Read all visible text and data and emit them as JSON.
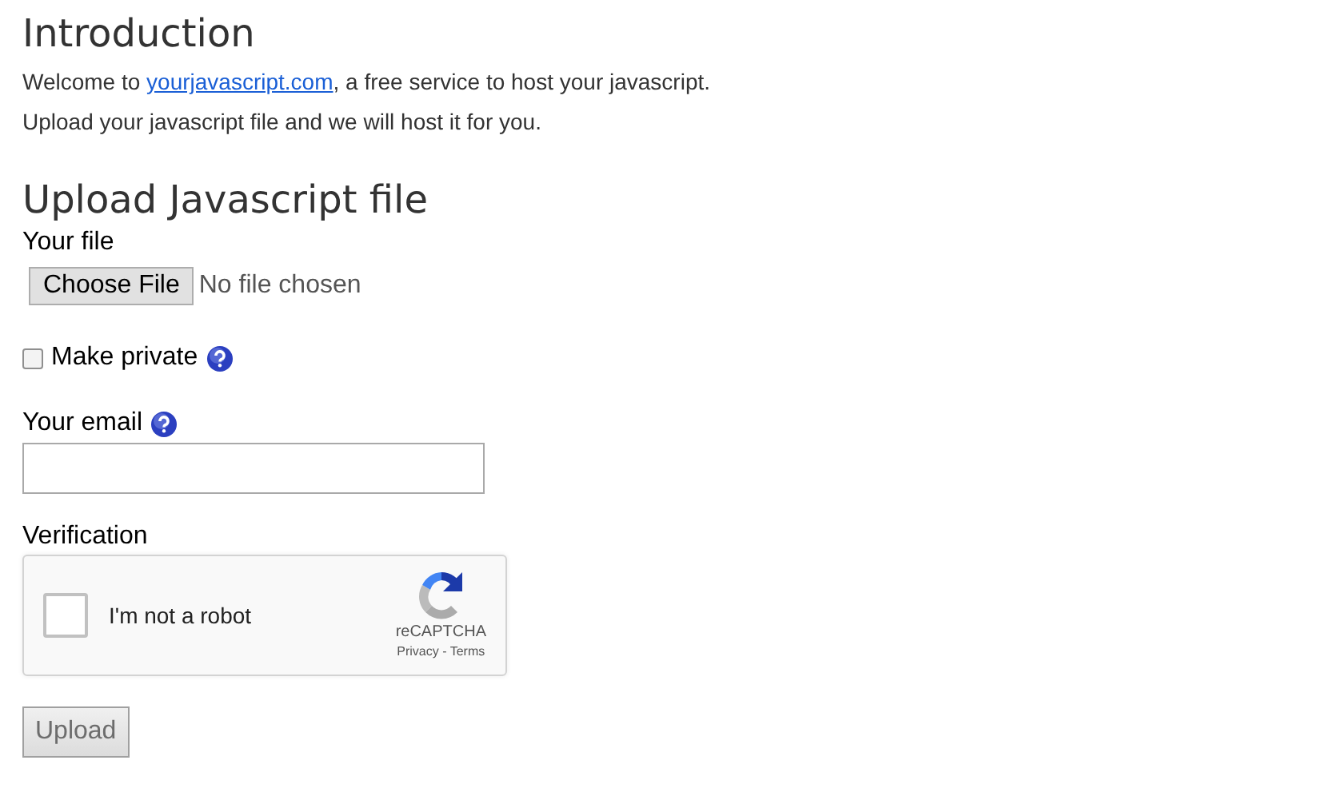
{
  "intro": {
    "title": "Introduction",
    "welcome_before": "Welcome to ",
    "link": "yourjavascript.com",
    "welcome_after": ", a free service to host your javascript.",
    "line2": "Upload your javascript file and we will host it for you."
  },
  "upload": {
    "title": "Upload Javascript file",
    "file_label": "Your file",
    "file_button": "Choose File",
    "file_status": "No file chosen",
    "private": {
      "label": "Make private",
      "checked": false
    },
    "email_label": "Your email",
    "verification_label": "Verification",
    "captcha": {
      "label": "I'm not a robot",
      "checked": false,
      "brand": "reCAPTCHA",
      "privacy": "Privacy",
      "sep": " - ",
      "terms": "Terms"
    },
    "submit": {
      "label": "Upload",
      "disabled": true
    }
  }
}
